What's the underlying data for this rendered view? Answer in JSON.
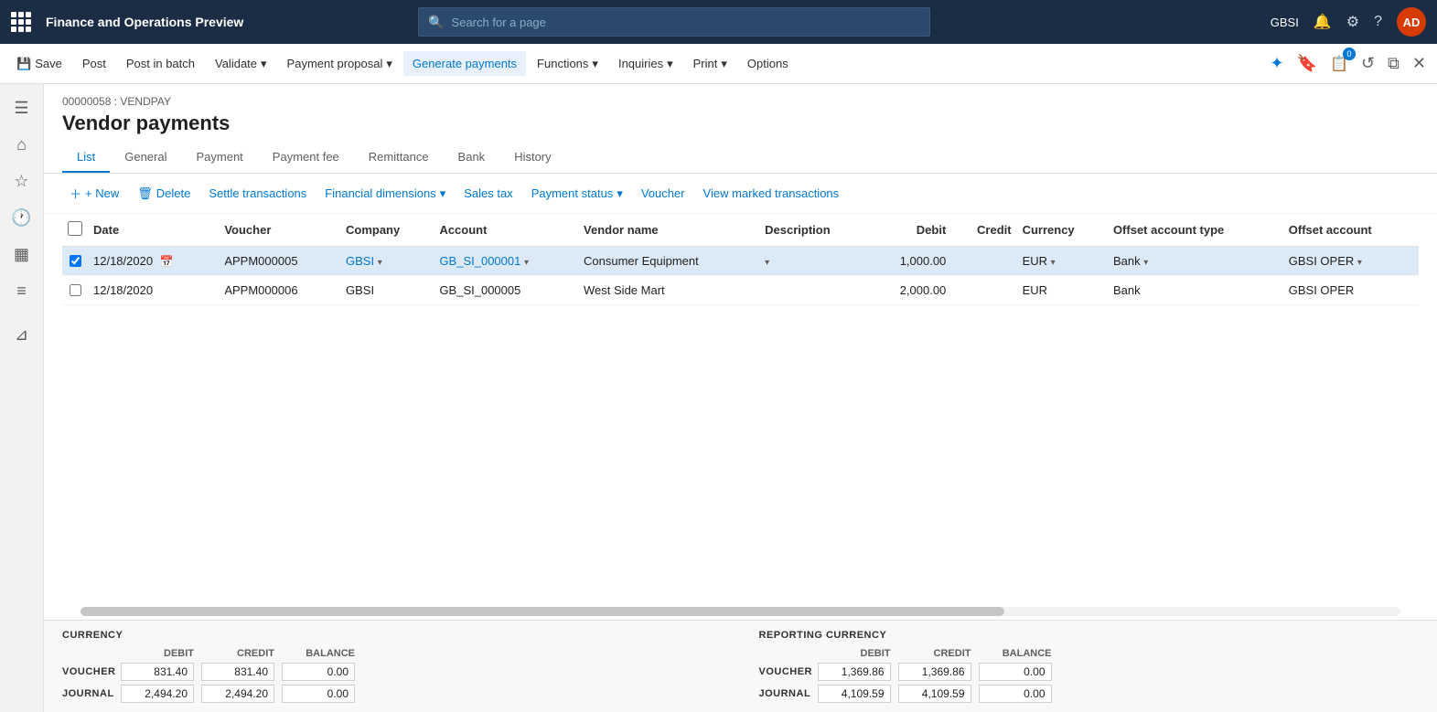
{
  "app": {
    "title": "Finance and Operations Preview",
    "user": "AD",
    "user_label": "GBSI",
    "search_placeholder": "Search for a page"
  },
  "toolbar": {
    "save_label": "Save",
    "post_label": "Post",
    "post_batch_label": "Post in batch",
    "validate_label": "Validate",
    "payment_proposal_label": "Payment proposal",
    "generate_payments_label": "Generate payments",
    "functions_label": "Functions",
    "inquiries_label": "Inquiries",
    "print_label": "Print",
    "options_label": "Options"
  },
  "page": {
    "breadcrumb": "00000058 : VENDPAY",
    "title": "Vendor payments"
  },
  "tabs": [
    {
      "id": "list",
      "label": "List",
      "active": true
    },
    {
      "id": "general",
      "label": "General",
      "active": false
    },
    {
      "id": "payment",
      "label": "Payment",
      "active": false
    },
    {
      "id": "payment_fee",
      "label": "Payment fee",
      "active": false
    },
    {
      "id": "remittance",
      "label": "Remittance",
      "active": false
    },
    {
      "id": "bank",
      "label": "Bank",
      "active": false
    },
    {
      "id": "history",
      "label": "History",
      "active": false
    }
  ],
  "actions": {
    "new_label": "+ New",
    "delete_label": "Delete",
    "settle_label": "Settle transactions",
    "financial_dims_label": "Financial dimensions",
    "sales_tax_label": "Sales tax",
    "payment_status_label": "Payment status",
    "voucher_label": "Voucher",
    "view_marked_label": "View marked transactions"
  },
  "table": {
    "columns": [
      {
        "id": "check",
        "label": ""
      },
      {
        "id": "date",
        "label": "Date"
      },
      {
        "id": "voucher",
        "label": "Voucher"
      },
      {
        "id": "company",
        "label": "Company"
      },
      {
        "id": "account",
        "label": "Account"
      },
      {
        "id": "vendor_name",
        "label": "Vendor name"
      },
      {
        "id": "description",
        "label": "Description"
      },
      {
        "id": "debit",
        "label": "Debit",
        "num": true
      },
      {
        "id": "credit",
        "label": "Credit",
        "num": true
      },
      {
        "id": "currency",
        "label": "Currency"
      },
      {
        "id": "offset_account_type",
        "label": "Offset account type"
      },
      {
        "id": "offset_account",
        "label": "Offset account"
      }
    ],
    "rows": [
      {
        "selected": true,
        "date": "12/18/2020",
        "voucher": "APPM000005",
        "company": "GBSI",
        "account": "GB_SI_000001",
        "vendor_name": "Consumer Equipment",
        "description": "",
        "debit": "1,000.00",
        "credit": "",
        "currency": "EUR",
        "offset_account_type": "Bank",
        "offset_account": "GBSI OPER"
      },
      {
        "selected": false,
        "date": "12/18/2020",
        "voucher": "APPM000006",
        "company": "GBSI",
        "account": "GB_SI_000005",
        "vendor_name": "West Side Mart",
        "description": "",
        "debit": "2,000.00",
        "credit": "",
        "currency": "EUR",
        "offset_account_type": "Bank",
        "offset_account": "GBSI OPER"
      }
    ]
  },
  "summary": {
    "currency": {
      "title": "CURRENCY",
      "headers": [
        "DEBIT",
        "CREDIT",
        "BALANCE"
      ],
      "rows": [
        {
          "label": "VOUCHER",
          "debit": "831.40",
          "credit": "831.40",
          "balance": "0.00"
        },
        {
          "label": "JOURNAL",
          "debit": "2,494.20",
          "credit": "2,494.20",
          "balance": "0.00"
        }
      ]
    },
    "reporting": {
      "title": "REPORTING CURRENCY",
      "headers": [
        "DEBIT",
        "CREDIT",
        "BALANCE"
      ],
      "rows": [
        {
          "label": "VOUCHER",
          "debit": "1,369.86",
          "credit": "1,369.86",
          "balance": "0.00"
        },
        {
          "label": "JOURNAL",
          "debit": "4,109.59",
          "credit": "4,109.59",
          "balance": "0.00"
        }
      ]
    }
  }
}
